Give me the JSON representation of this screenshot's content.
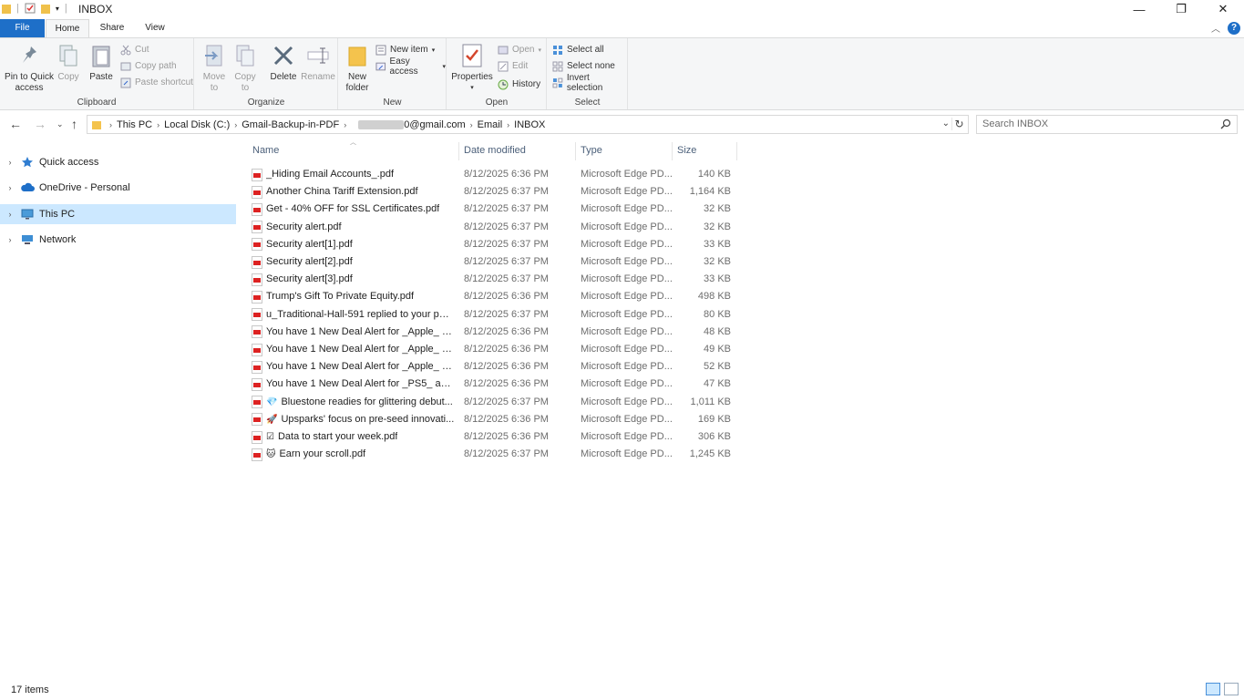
{
  "window": {
    "title": "INBOX"
  },
  "tabs": {
    "file": "File",
    "home": "Home",
    "share": "Share",
    "view": "View"
  },
  "ribbon": {
    "clipboard": {
      "label": "Clipboard",
      "pin": "Pin to Quick access",
      "copy": "Copy",
      "paste": "Paste",
      "cut": "Cut",
      "copy_path": "Copy path",
      "paste_shortcut": "Paste shortcut"
    },
    "organize": {
      "label": "Organize",
      "move_to": "Move to",
      "copy_to": "Copy to",
      "delete": "Delete",
      "rename": "Rename"
    },
    "new": {
      "label": "New",
      "new_folder": "New folder",
      "new_item": "New item",
      "easy_access": "Easy access"
    },
    "open": {
      "label": "Open",
      "properties": "Properties",
      "open": "Open",
      "edit": "Edit",
      "history": "History"
    },
    "select": {
      "label": "Select",
      "select_all": "Select all",
      "select_none": "Select none",
      "invert": "Invert selection"
    }
  },
  "address": {
    "crumbs": [
      "This PC",
      "Local Disk (C:)",
      "Gmail-Backup-in-PDF",
      "0@gmail.com",
      "Email",
      "INBOX"
    ],
    "search_placeholder": "Search INBOX"
  },
  "navpane": [
    {
      "label": "Quick access",
      "icon": "star-icon"
    },
    {
      "label": "OneDrive - Personal",
      "icon": "cloud-icon"
    },
    {
      "label": "This PC",
      "icon": "computer-icon",
      "selected": true
    },
    {
      "label": "Network",
      "icon": "network-icon"
    }
  ],
  "columns": {
    "name": "Name",
    "date": "Date modified",
    "type": "Type",
    "size": "Size"
  },
  "files": [
    {
      "icon": "pdf-icon",
      "name": "_Hiding Email Accounts_.pdf",
      "date": "8/12/2025 6:36 PM",
      "type": "Microsoft Edge PD...",
      "size": "140 KB"
    },
    {
      "icon": "pdf-icon",
      "name": "Another China Tariff Extension.pdf",
      "date": "8/12/2025 6:37 PM",
      "type": "Microsoft Edge PD...",
      "size": "1,164 KB"
    },
    {
      "icon": "pdf-icon",
      "name": "Get - 40% OFF for SSL Certificates.pdf",
      "date": "8/12/2025 6:37 PM",
      "type": "Microsoft Edge PD...",
      "size": "32 KB"
    },
    {
      "icon": "pdf-icon",
      "name": "Security alert.pdf",
      "date": "8/12/2025 6:37 PM",
      "type": "Microsoft Edge PD...",
      "size": "32 KB"
    },
    {
      "icon": "pdf-icon",
      "name": "Security alert[1].pdf",
      "date": "8/12/2025 6:37 PM",
      "type": "Microsoft Edge PD...",
      "size": "33 KB"
    },
    {
      "icon": "pdf-icon",
      "name": "Security alert[2].pdf",
      "date": "8/12/2025 6:37 PM",
      "type": "Microsoft Edge PD...",
      "size": "32 KB"
    },
    {
      "icon": "pdf-icon",
      "name": "Security alert[3].pdf",
      "date": "8/12/2025 6:37 PM",
      "type": "Microsoft Edge PD...",
      "size": "33 KB"
    },
    {
      "icon": "pdf-icon",
      "name": "Trump's Gift To Private Equity.pdf",
      "date": "8/12/2025 6:36 PM",
      "type": "Microsoft Edge PD...",
      "size": "498 KB"
    },
    {
      "icon": "pdf-icon",
      "name": "u_Traditional-Hall-591 replied to your po...",
      "date": "8/12/2025 6:37 PM",
      "type": "Microsoft Edge PD...",
      "size": "80 KB"
    },
    {
      "icon": "pdf-icon",
      "name": "You have 1 New Deal Alert for _Apple_ at...",
      "date": "8/12/2025 6:36 PM",
      "type": "Microsoft Edge PD...",
      "size": "48 KB"
    },
    {
      "icon": "pdf-icon",
      "name": "You have 1 New Deal Alert for _Apple_ at...",
      "date": "8/12/2025 6:36 PM",
      "type": "Microsoft Edge PD...",
      "size": "49 KB"
    },
    {
      "icon": "pdf-icon",
      "name": "You have 1 New Deal Alert for _Apple_ at...",
      "date": "8/12/2025 6:36 PM",
      "type": "Microsoft Edge PD...",
      "size": "52 KB"
    },
    {
      "icon": "pdf-icon",
      "name": "You have 1 New Deal Alert for _PS5_ at R...",
      "date": "8/12/2025 6:36 PM",
      "type": "Microsoft Edge PD...",
      "size": "47 KB"
    },
    {
      "icon": "pdf-icon",
      "glyph": "💎",
      "name": "Bluestone readies for glittering debut...",
      "date": "8/12/2025 6:37 PM",
      "type": "Microsoft Edge PD...",
      "size": "1,011 KB"
    },
    {
      "icon": "pdf-icon",
      "glyph": "🚀",
      "name": "Upsparks' focus on pre-seed innovati...",
      "date": "8/12/2025 6:36 PM",
      "type": "Microsoft Edge PD...",
      "size": "169 KB"
    },
    {
      "icon": "pdf-icon",
      "glyph": "☑",
      "name": "Data to start your week.pdf",
      "date": "8/12/2025 6:36 PM",
      "type": "Microsoft Edge PD...",
      "size": "306 KB"
    },
    {
      "icon": "pdf-icon",
      "glyph": "🐱",
      "name": "Earn your scroll.pdf",
      "date": "8/12/2025 6:37 PM",
      "type": "Microsoft Edge PD...",
      "size": "1,245 KB"
    }
  ],
  "status": {
    "count": "17 items"
  },
  "colors": {
    "accent": "#1e6fc8",
    "selection": "#cce8ff",
    "pdf_red": "#dd2222"
  }
}
